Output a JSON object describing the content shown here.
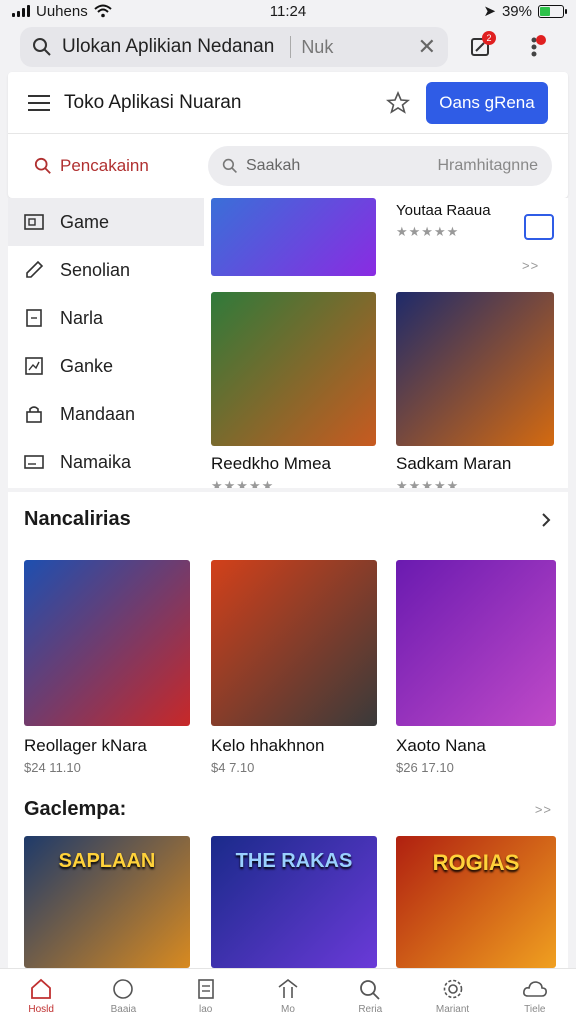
{
  "status": {
    "carrier": "Uuhens",
    "time": "11:24",
    "battery": "39%"
  },
  "topbar": {
    "search_text": "Ulokan Aplikian Nedanan",
    "search_suffix": "Nuk",
    "notif_count": "2"
  },
  "store": {
    "title": "Toko Aplikasi Nuaran",
    "open_button": "Oans gRena",
    "category_label": "Pencakainn",
    "search_placeholder": "Saakah",
    "search_hint": "Hramhitagnne"
  },
  "sidebar": {
    "items": [
      {
        "label": "Game",
        "icon": "game-icon",
        "active": true
      },
      {
        "label": "Senolian",
        "icon": "pen-icon"
      },
      {
        "label": "Narla",
        "icon": "note-icon"
      },
      {
        "label": "Ganke",
        "icon": "chart-icon"
      },
      {
        "label": "Mandaan",
        "icon": "lock-icon"
      },
      {
        "label": "Namaika",
        "icon": "card-icon"
      }
    ]
  },
  "upper_grid": {
    "items": [
      {
        "title": "",
        "sub": "",
        "colors": [
          "#3a6fd8",
          "#8a2be2"
        ]
      },
      {
        "title": "Youtaa Raaua",
        "sub": "★★★★★",
        "colors": []
      },
      {
        "title": "Reedkho Mmea",
        "sub": "★★★★★",
        "colors": [
          "#2f7a3a",
          "#c85a20"
        ]
      },
      {
        "title": "Sadkam Maran",
        "sub": "★★★★★",
        "colors": [
          "#1e2a6a",
          "#d46a10"
        ]
      }
    ],
    "more_link": ">>"
  },
  "section1": {
    "title": "Nancalirias",
    "items": [
      {
        "title": "Reollager kNara",
        "price": "$24 11.10",
        "colors": [
          "#1d4fb0",
          "#c82828"
        ]
      },
      {
        "title": "Kelo hhakhnon",
        "price": "$4 7.10",
        "colors": [
          "#d2401a",
          "#3a3a3a"
        ]
      },
      {
        "title": "Xaoto Nana",
        "price": "$26 17.10",
        "colors": [
          "#6a1ab0",
          "#c04ac8"
        ]
      }
    ]
  },
  "section2": {
    "title": "Gaclempa:",
    "more_link": ">>",
    "items": [
      {
        "banner": "SAPLAAN",
        "colors": [
          "#1e3a6a",
          "#d88a20"
        ]
      },
      {
        "banner": "THE RAKAS",
        "colors": [
          "#1a2a8a",
          "#6a3ad8"
        ]
      },
      {
        "banner": "ROGIAS",
        "colors": [
          "#b02010",
          "#f0a020"
        ]
      }
    ]
  },
  "bottomnav": {
    "items": [
      {
        "label": "Hosld",
        "icon": "home-icon",
        "active": true
      },
      {
        "label": "Baaia",
        "icon": "compass-icon"
      },
      {
        "label": "lao",
        "icon": "list-icon"
      },
      {
        "label": "Mo",
        "icon": "store-icon"
      },
      {
        "label": "Reria",
        "icon": "search-icon"
      },
      {
        "label": "Mariant",
        "icon": "settings-icon"
      },
      {
        "label": "Tiele",
        "icon": "cloud-icon"
      }
    ]
  }
}
